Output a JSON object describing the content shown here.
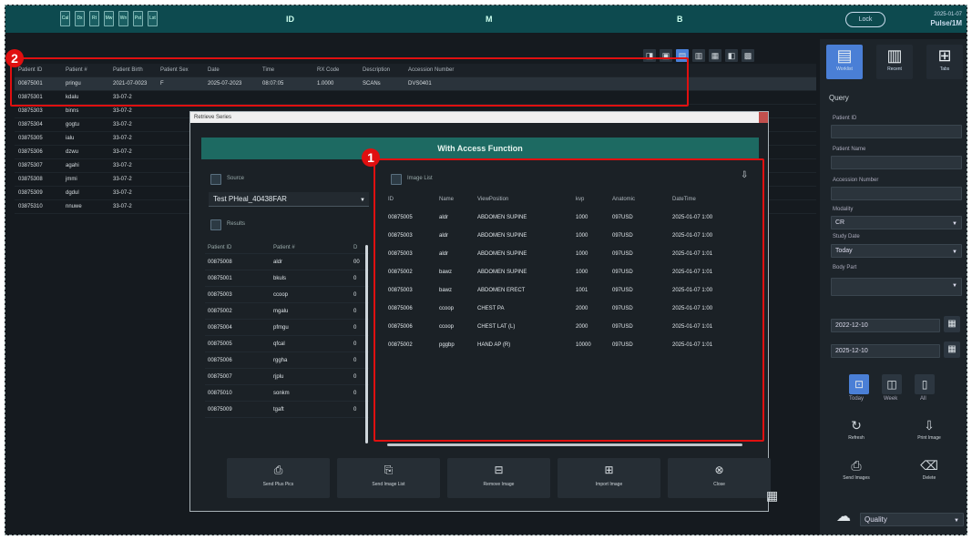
{
  "topbar": {
    "icons": [
      "Cal",
      "Dx",
      "Rt",
      "Mw",
      "Wn",
      "Pst",
      "Lst"
    ],
    "labels": [
      "ID",
      "M",
      "B"
    ],
    "login": "Lock",
    "time_line1": "2025-01-07",
    "time_line2": "Pulse/1M"
  },
  "main_table": {
    "headers": [
      "Patient ID",
      "Patient #",
      "Patient Birth",
      "Patient Sex",
      "Date",
      "Time",
      "RX Code",
      "Description",
      "Accession Number"
    ],
    "rows": [
      [
        "00875001",
        "pringu",
        "2021-07-0023",
        "F",
        "2025-07-2023",
        "08:07:05",
        "1.0000",
        "SCANs",
        "DVS0401"
      ],
      [
        "03875301",
        "kdalu",
        "33-07-2"
      ],
      [
        "03875303",
        "binns",
        "33-07-2"
      ],
      [
        "03875304",
        "gogtu",
        "33-07-2"
      ],
      [
        "03875305",
        "ialu",
        "33-07-2"
      ],
      [
        "03875306",
        "dzwu",
        "33-07-2"
      ],
      [
        "03875307",
        "agahi",
        "33-07-2"
      ],
      [
        "03875308",
        "jmmi",
        "33-07-2"
      ],
      [
        "03875309",
        "dgdul",
        "33-07-2"
      ],
      [
        "03875310",
        "nnuwe",
        "33-07-2"
      ]
    ]
  },
  "toolbar_icons": [
    "◨",
    "▣",
    "▤",
    "▥",
    "▦",
    "◧",
    "▩"
  ],
  "dialog": {
    "title": "Retrieve Series",
    "banner": "With Access Function",
    "source_label": "Source",
    "source_value": "Test PHeal_40438FAR",
    "results_label": "Results",
    "image_list_label": "Image List",
    "left_headers": [
      "Patient ID",
      "Patient #",
      "D"
    ],
    "left_rows": [
      [
        "00875008",
        "aldr",
        "00"
      ],
      [
        "00875001",
        "bkuls",
        "0"
      ],
      [
        "00875003",
        "ccoop",
        "0"
      ],
      [
        "00875002",
        "mgalu",
        "0"
      ],
      [
        "00875004",
        "pfmgu",
        "0"
      ],
      [
        "00875005",
        "qfcal",
        "0"
      ],
      [
        "00875006",
        "rggha",
        "0"
      ],
      [
        "00875007",
        "rjplu",
        "0"
      ],
      [
        "00875010",
        "sonkm",
        "0"
      ],
      [
        "00875009",
        "tgaft",
        "0"
      ]
    ],
    "right_headers": [
      "ID",
      "Name",
      "ViewPosition",
      "kvp",
      "Anatomic",
      "DateTime"
    ],
    "right_rows": [
      [
        "00875005",
        "aldr",
        "ABDOMEN SUPINE",
        "1000",
        "097USD",
        "2025-01-07 1:00"
      ],
      [
        "00875003",
        "aldr",
        "ABDOMEN SUPINE",
        "1000",
        "097USD",
        "2025-01-07 1:00"
      ],
      [
        "00875003",
        "aldr",
        "ABDOMEN SUPINE",
        "1000",
        "097USD",
        "2025-01-07 1:01"
      ],
      [
        "00875002",
        "bawz",
        "ABDOMEN SUPINE",
        "1000",
        "097USD",
        "2025-01-07 1:01"
      ],
      [
        "00875003",
        "bawz",
        "ABDOMEN ERECT",
        "1001",
        "097USD",
        "2025-01-07 1:00"
      ],
      [
        "00875006",
        "ccoop",
        "CHEST PA",
        "2000",
        "097USD",
        "2025-01-07 1:00"
      ],
      [
        "00875006",
        "ccoop",
        "CHEST LAT (L)",
        "2000",
        "097USD",
        "2025-01-07 1:01"
      ],
      [
        "00875002",
        "pggbp",
        "HAND AP (R)",
        "10000",
        "097USD",
        "2025-01-07 1:01"
      ]
    ],
    "buttons": [
      "Send Plus Pics",
      "Send Image List",
      "Remove Image",
      "Import Image",
      "Close"
    ],
    "button_icons": [
      "⎙",
      "⎘",
      "⊟",
      "⊞",
      "⊗"
    ]
  },
  "side": {
    "view_buttons": [
      "Worklist",
      "Recent",
      "Tabs"
    ],
    "query_label": "Query",
    "fields": [
      {
        "label": "Patient ID",
        "value": ""
      },
      {
        "label": "Patient Name",
        "value": ""
      },
      {
        "label": "Accession Number",
        "value": ""
      }
    ],
    "modality_label": "Modality",
    "modality_value": "CR",
    "date_range_label": "Study Date",
    "date_range_value": "Today",
    "body_part_label": "Body Part",
    "date_from": "2022-12-10",
    "date_to": "2025-12-10",
    "small_labels": [
      "Today",
      "Week",
      "All"
    ],
    "actions": [
      "Refresh",
      "Print Image",
      "Send Images",
      "Delete"
    ],
    "action_icons": [
      "↻",
      "⇩",
      "⎙",
      "⌫"
    ],
    "bottom_value": "Quality"
  },
  "badges": [
    "1",
    "2"
  ]
}
